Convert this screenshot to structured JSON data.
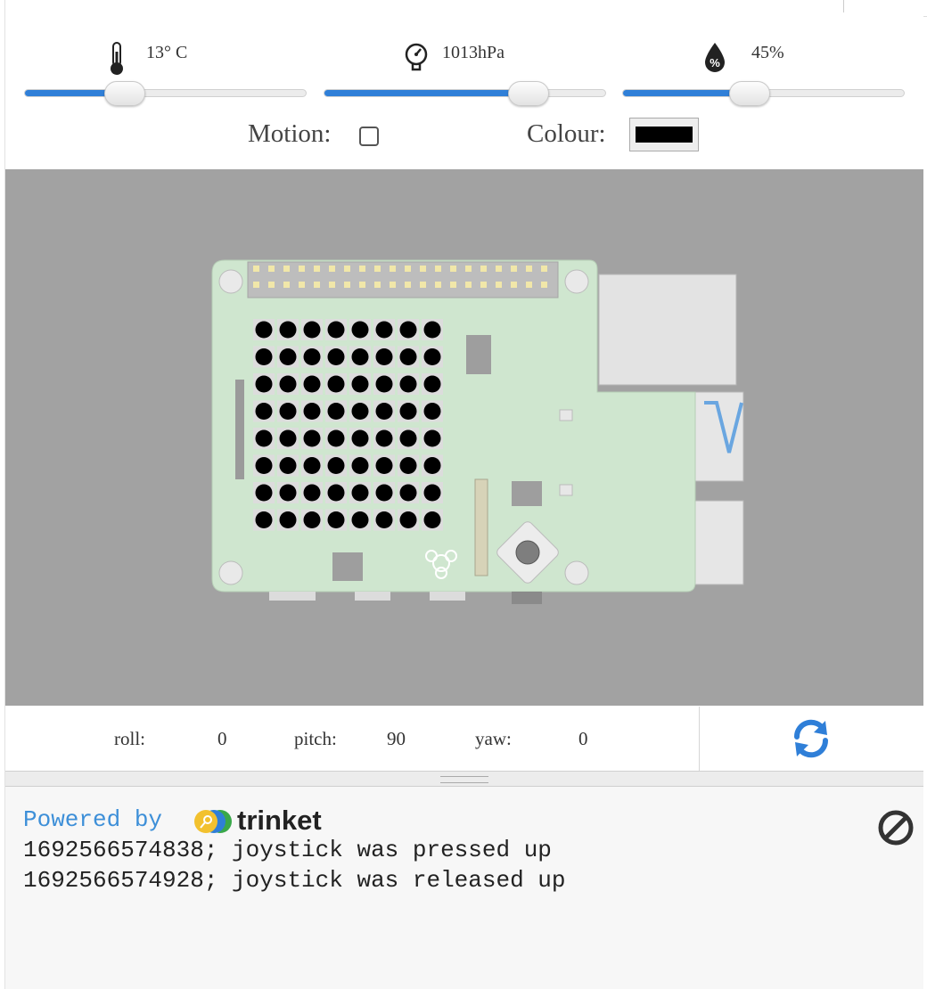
{
  "sensors": {
    "temperature": {
      "label": "13° C",
      "icon": "thermometer-icon",
      "level": 0.36
    },
    "pressure": {
      "label": "1013hPa",
      "icon": "gauge-icon",
      "level": 0.71
    },
    "humidity": {
      "label": "45%",
      "icon": "humidity-drop-icon",
      "level": 0.45
    }
  },
  "motion": {
    "label": "Motion:",
    "checked": false
  },
  "colour": {
    "label": "Colour:",
    "value": "#000000"
  },
  "orientation": {
    "roll_label": "roll:",
    "roll": "0",
    "pitch_label": "pitch:",
    "pitch": "90",
    "yaw_label": "yaw:",
    "yaw": "0"
  },
  "console": {
    "powered_by": "Powered by",
    "brand": "trinket",
    "lines": [
      "1692566574838; joystick was pressed up",
      "1692566574928; joystick was released up"
    ]
  },
  "colors": {
    "accent": "#2f7fd8",
    "stage": "#a2a2a2",
    "board": "#cfe6cf"
  }
}
